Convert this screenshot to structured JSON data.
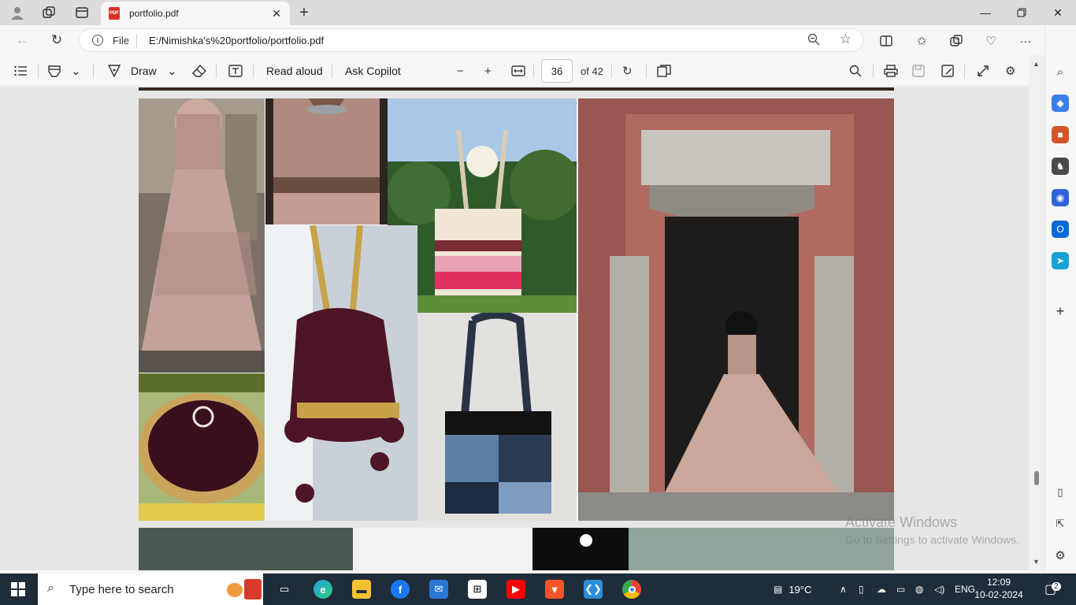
{
  "browser": {
    "tab": {
      "title": "portfolio.pdf",
      "icon": "pdf-icon"
    },
    "address": {
      "scheme": "File",
      "url": "E:/Nimishka's%20portfolio/portfolio.pdf"
    }
  },
  "pdf_toolbar": {
    "draw_label": "Draw",
    "read_aloud_label": "Read aloud",
    "ask_copilot_label": "Ask Copilot",
    "page_number": "36",
    "page_total": "of 42"
  },
  "watermark": {
    "line1": "Activate Windows",
    "line2": "Go to Settings to activate Windows."
  },
  "taskbar": {
    "search_placeholder": "Type here to search",
    "weather": "19°C",
    "language": "ENG",
    "time": "12:09",
    "date": "10-02-2024",
    "notification_count": "2"
  },
  "colors": {
    "accent": "#0067c0",
    "taskbar_bg": "#1f2c3a",
    "pdf_red": "#d93025"
  }
}
